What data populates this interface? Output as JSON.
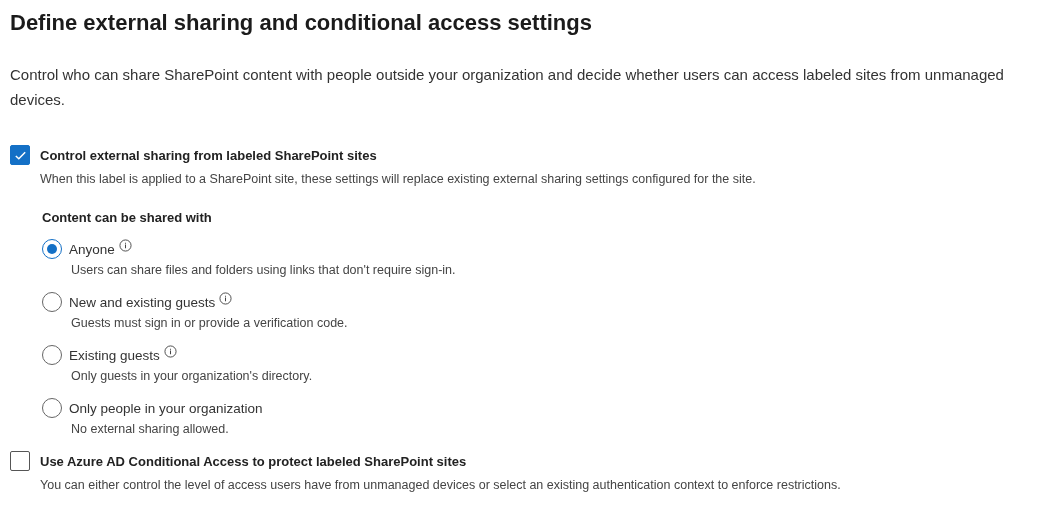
{
  "title": "Define external sharing and conditional access settings",
  "description": "Control who can share SharePoint content with people outside your organization and decide whether users can access labeled sites from unmanaged devices.",
  "settings": [
    {
      "label": "Control external sharing from labeled SharePoint sites",
      "checked": true,
      "description": "When this label is applied to a SharePoint site, these settings will replace existing external sharing settings configured for the site.",
      "options_heading": "Content can be shared with",
      "options": [
        {
          "label": "Anyone",
          "info": true,
          "selected": true,
          "description": "Users can share files and folders using links that don't require sign-in."
        },
        {
          "label": "New and existing guests",
          "info": true,
          "selected": false,
          "description": "Guests must sign in or provide a verification code."
        },
        {
          "label": "Existing guests",
          "info": true,
          "selected": false,
          "description": "Only guests in your organization's directory."
        },
        {
          "label": "Only people in your organization",
          "info": false,
          "selected": false,
          "description": "No external sharing allowed."
        }
      ]
    },
    {
      "label": "Use Azure AD Conditional Access to protect labeled SharePoint sites",
      "checked": false,
      "description": "You can either control the level of access users have from unmanaged devices or select an existing authentication context to enforce restrictions."
    }
  ]
}
